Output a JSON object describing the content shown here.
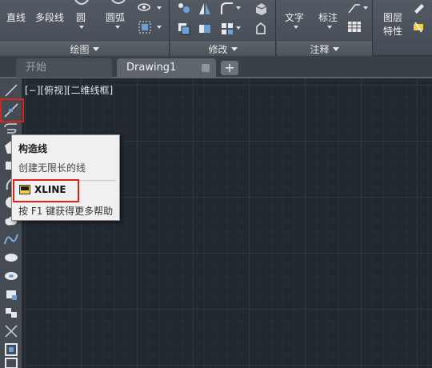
{
  "ribbon": {
    "draw_panel": {
      "title": "绘图",
      "tools": [
        {
          "label": "直线"
        },
        {
          "label": "多段线"
        },
        {
          "label": "圆"
        },
        {
          "label": "圆弧"
        }
      ]
    },
    "modify_panel": {
      "title": "修改"
    },
    "annotation_panel": {
      "title": "注释",
      "tools": [
        {
          "label": "文字"
        },
        {
          "label": "标注"
        }
      ]
    },
    "properties_panel": {
      "label_line1": "图层",
      "label_line2": "特性"
    }
  },
  "tabs": [
    {
      "label": "开始",
      "active": false
    },
    {
      "label": "Drawing1",
      "active": true
    }
  ],
  "tab_add_label": "+",
  "viewport_label": "[−][俯视][二维线框]",
  "tooltip": {
    "title": "构造线",
    "description": "创建无限长的线",
    "command": "XLINE",
    "help": "按 F1 键获得更多帮助"
  },
  "colors": {
    "canvas_bg": "#212830",
    "highlight": "#e0201b",
    "ribbon_bg": "#4b525a",
    "tooltip_bg": "#f0f0f0"
  },
  "left_toolbar_icons": [
    "line-icon",
    "xline-icon",
    "polyline-icon",
    "polygon-icon",
    "rectangle-icon",
    "arc-icon",
    "circle-icon",
    "revcloud-icon",
    "spline-icon",
    "ellipse-icon",
    "ellipse-arc-icon",
    "insert-block-icon",
    "make-block-icon",
    "point-icon",
    "hatch-icon",
    "gradient-icon"
  ]
}
